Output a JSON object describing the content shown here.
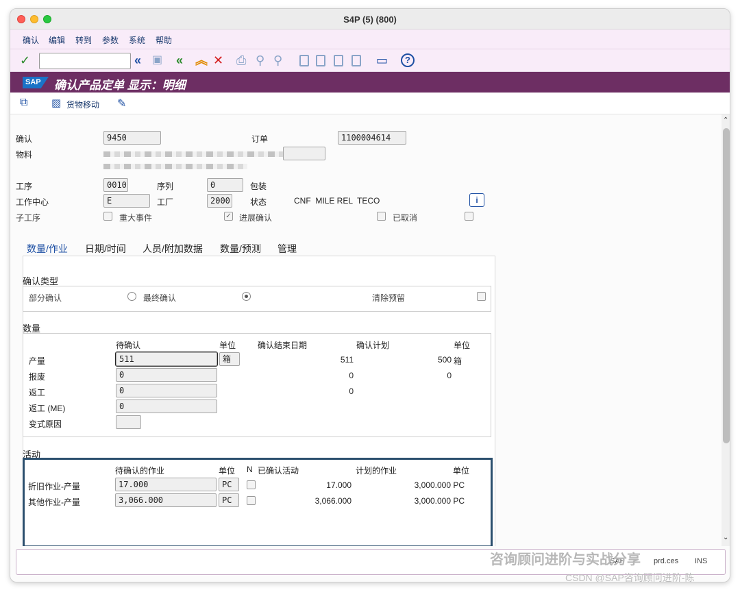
{
  "window": {
    "title": "S4P (5) (800)"
  },
  "menu": [
    "确认",
    "编辑",
    "转到",
    "参数",
    "系统",
    "帮助"
  ],
  "banner": {
    "title": "确认产品定单 显示：明细",
    "logo": "SAP"
  },
  "app_toolbar": {
    "goods_movement": "货物移动"
  },
  "header": {
    "confirmation_label": "确认",
    "confirmation_value": "9450",
    "order_label": "订单",
    "order_value": "1100004614",
    "material_label": "物料",
    "operation_label": "工序",
    "operation_value": "0010",
    "sequence_label": "序列",
    "sequence_value": "0",
    "packaging_label": "包装",
    "workcenter_label": "工作中心",
    "workcenter_value": "E",
    "plant_label": "工厂",
    "plant_value": "2000",
    "status_label": "状态",
    "status_value": "CNF  MILE REL  TECO",
    "suboperation_label": "子工序",
    "major_event_label": "重大事件",
    "progress_confirm_label": "进展确认",
    "cancelled_label": "已取消"
  },
  "tabs": [
    "数量/作业",
    "日期/时间",
    "人员/附加数据",
    "数量/预测",
    "管理"
  ],
  "confirm_type": {
    "title": "确认类型",
    "partial": "部分确认",
    "final": "最终确认",
    "clear_reservation": "清除预留"
  },
  "quantity": {
    "title": "数量",
    "col_to_confirm": "待确认",
    "col_unit": "单位",
    "col_end_date": "确认结束日期",
    "col_plan": "确认计划",
    "col_unit2": "单位",
    "rows": [
      {
        "label": "产量",
        "value": "511",
        "unit": "箱",
        "confirmed": "511",
        "plan": "500",
        "plan_unit": "箱"
      },
      {
        "label": "报废",
        "value": "0",
        "unit": "",
        "confirmed": "0",
        "plan": "0",
        "plan_unit": ""
      },
      {
        "label": "返工",
        "value": "0",
        "unit": "",
        "confirmed": "0",
        "plan": "",
        "plan_unit": ""
      },
      {
        "label": "返工 (ME)",
        "value": "0",
        "unit": "",
        "confirmed": "",
        "plan": "",
        "plan_unit": ""
      },
      {
        "label": "变式原因",
        "value": "",
        "unit": "",
        "confirmed": "",
        "plan": "",
        "plan_unit": ""
      }
    ]
  },
  "activity": {
    "title": "活动",
    "col_to_confirm": "待确认的作业",
    "col_unit": "单位",
    "col_n": "N",
    "col_confirmed": "已确认活动",
    "col_planned": "计划的作业",
    "col_unit2": "单位",
    "rows": [
      {
        "label": "折旧作业-产量",
        "value": "17.000",
        "unit": "PC",
        "confirmed": "17.000",
        "planned": "3,000.000 PC"
      },
      {
        "label": "其他作业-产量",
        "value": "3,066.000",
        "unit": "PC",
        "confirmed": "3,066.000",
        "planned": "3,000.000 PC"
      }
    ]
  },
  "statusbar": {
    "sap_text": "SAP",
    "mid_text": "prd.ces",
    "right_text": "INS"
  },
  "watermark": {
    "line1": "咨询顾问进阶与实战分享",
    "line2": "CSDN @SAP咨询顾问进阶-陈"
  },
  "colors": {
    "banner": "#6d2e63",
    "menu_bg": "#f9ecf9",
    "accent": "#1d4fa3"
  }
}
